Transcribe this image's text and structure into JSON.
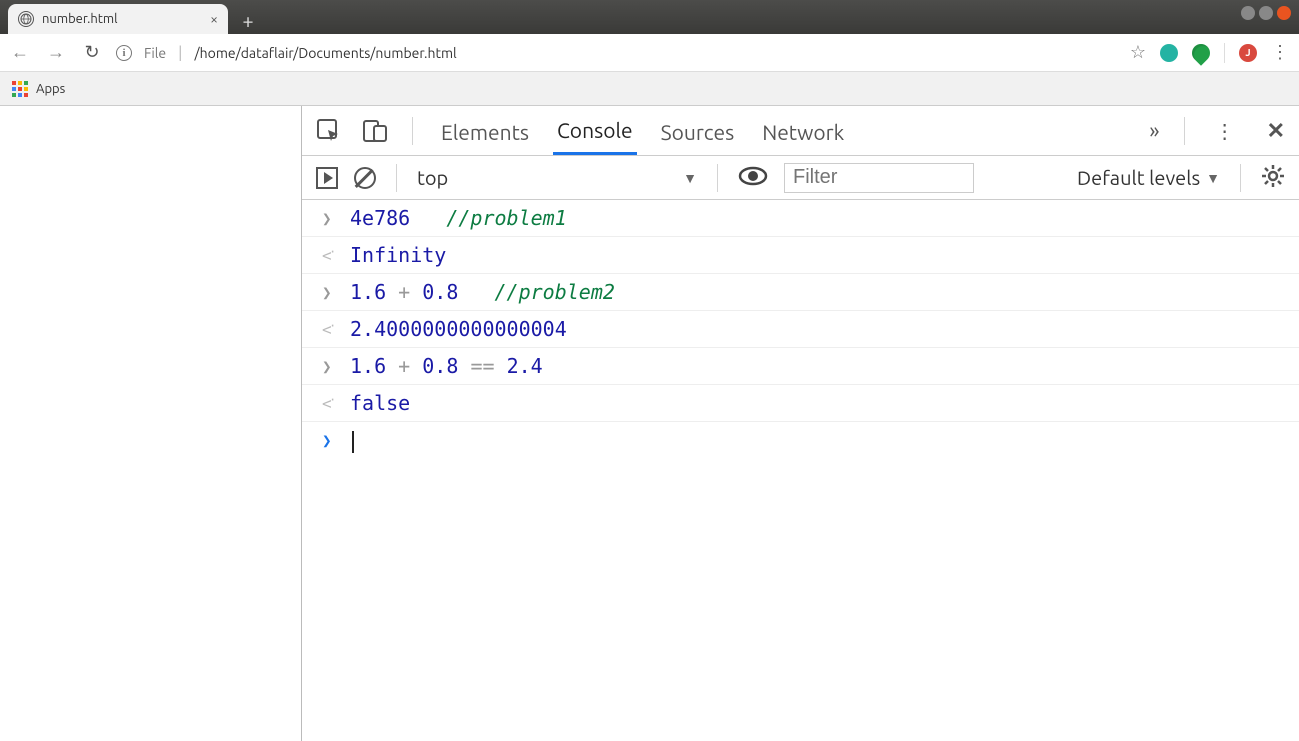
{
  "window": {
    "tab_title": "number.html"
  },
  "address": {
    "scheme": "File",
    "path": "/home/dataflair/Documents/number.html",
    "profile_letter": "J"
  },
  "bookmarks": {
    "apps": "Apps"
  },
  "devtools": {
    "tabs": {
      "elements": "Elements",
      "console": "Console",
      "sources": "Sources",
      "network": "Network"
    },
    "filter": {
      "context": "top",
      "filter_placeholder": "Filter",
      "levels": "Default levels"
    }
  },
  "console": {
    "rows": [
      {
        "type": "in",
        "tokens": [
          [
            "num",
            "4e786"
          ],
          [
            "sp",
            "   "
          ],
          [
            "comment",
            "//problem1"
          ]
        ]
      },
      {
        "type": "out",
        "tokens": [
          [
            "resnum",
            "Infinity"
          ]
        ]
      },
      {
        "type": "in",
        "tokens": [
          [
            "num",
            "1.6"
          ],
          [
            "sp",
            " "
          ],
          [
            "op",
            "+"
          ],
          [
            "sp",
            " "
          ],
          [
            "num",
            "0.8"
          ],
          [
            "sp",
            "   "
          ],
          [
            "comment",
            "//problem2"
          ]
        ]
      },
      {
        "type": "out",
        "tokens": [
          [
            "resnum",
            "2.4000000000000004"
          ]
        ]
      },
      {
        "type": "in",
        "tokens": [
          [
            "num",
            "1.6"
          ],
          [
            "sp",
            " "
          ],
          [
            "op",
            "+"
          ],
          [
            "sp",
            " "
          ],
          [
            "num",
            "0.8"
          ],
          [
            "sp",
            " "
          ],
          [
            "op",
            "=="
          ],
          [
            "sp",
            " "
          ],
          [
            "num",
            "2.4"
          ]
        ]
      },
      {
        "type": "out",
        "tokens": [
          [
            "resnum",
            "false"
          ]
        ]
      }
    ]
  }
}
